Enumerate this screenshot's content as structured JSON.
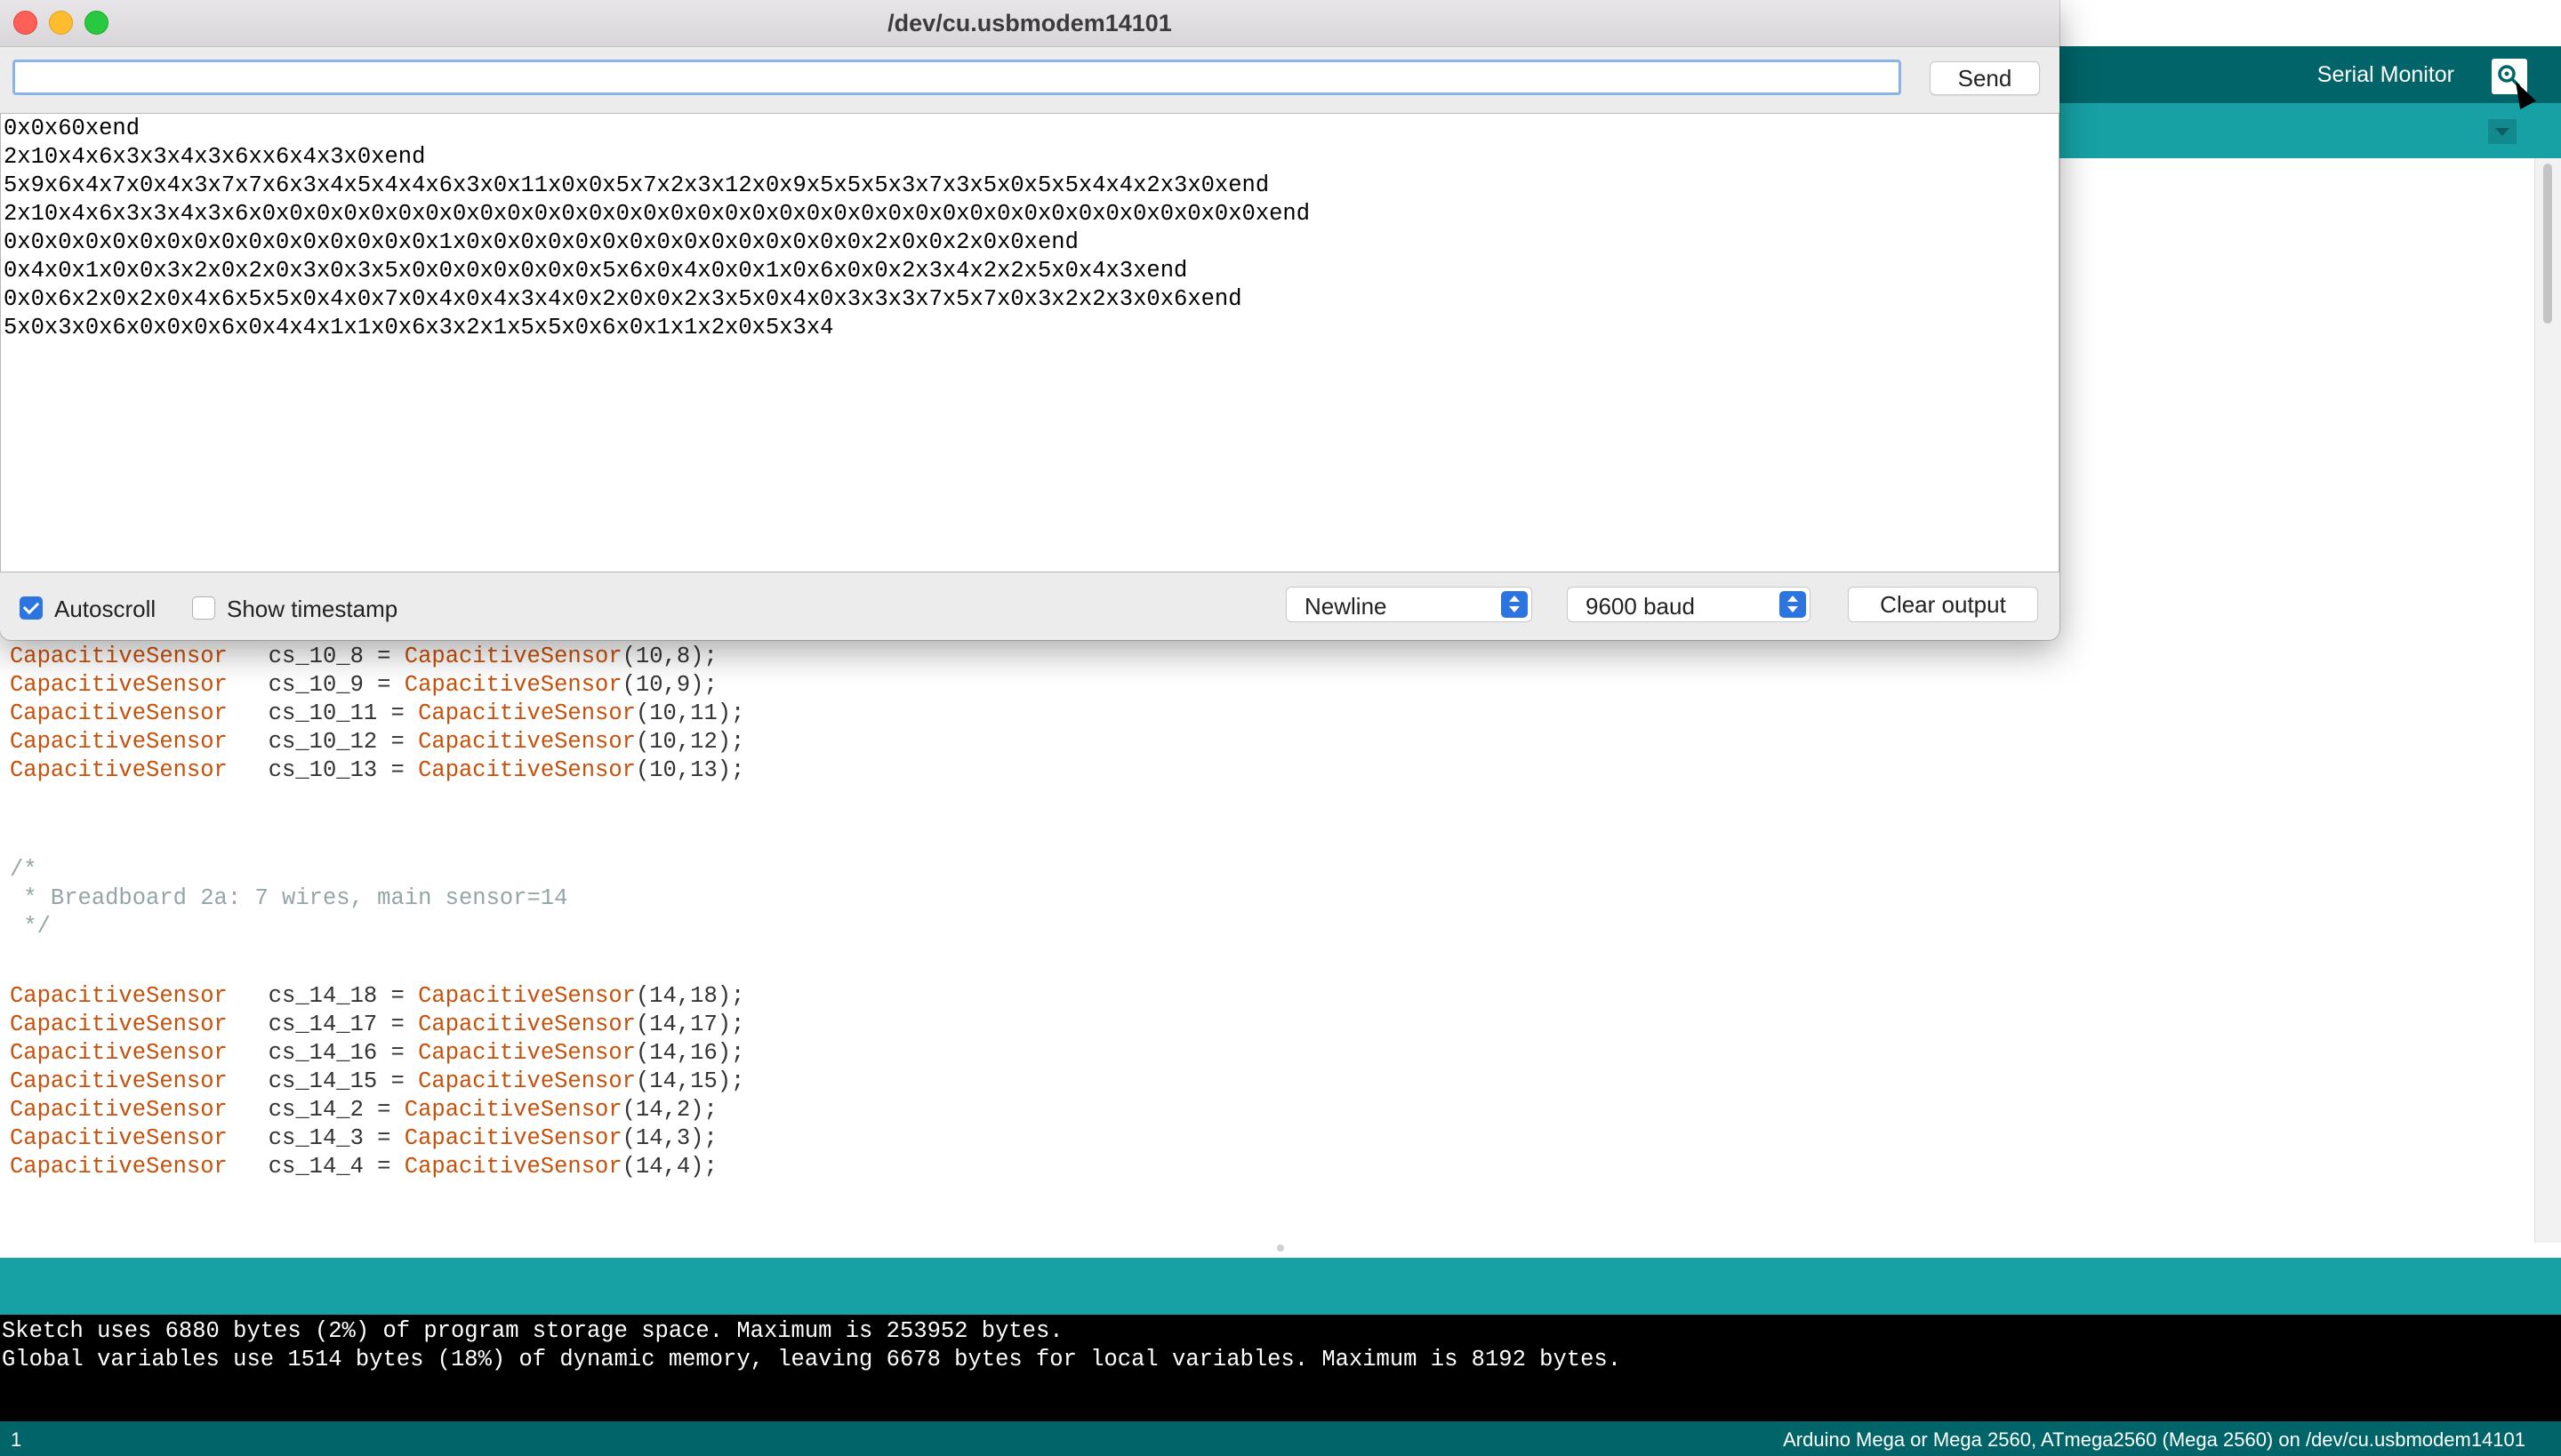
{
  "window": {
    "title": "/dev/cu.usbmodem14101"
  },
  "send": {
    "input_value": "",
    "send_label": "Send"
  },
  "output_lines": [
    "0x0x60xend",
    "2x10x4x6x3x3x4x3x6xx6x4x3x0xend",
    "5x9x6x4x7x0x4x3x7x7x6x3x4x5x4x4x6x3x0x11x0x0x5x7x2x3x12x0x9x5x5x5x3x7x3x5x0x5x5x4x4x2x3x0xend",
    "2x10x4x6x3x3x4x3x6x0x0x0x0x0x0x0x0x0x0x0x0x0x0x0x0x0x0x0x0x0x0x0x0x0x0x0x0x0x0x0x0x0x0x0x0x0xend",
    "0x0x0x0x0x0x0x0x0x0x0x0x0x0x0x0x1x0x0x0x0x0x0x0x0x0x0x0x0x0x0x0x2x0x0x2x0x0xend",
    "0x4x0x1x0x0x3x2x0x2x0x3x0x3x5x0x0x0x0x0x0x0x5x6x0x4x0x0x1x0x6x0x0x2x3x4x2x2x5x0x4x3xend",
    "0x0x6x2x0x2x0x4x6x5x5x0x4x0x7x0x4x0x4x3x4x0x2x0x0x2x3x5x0x4x0x3x3x3x7x5x7x0x3x2x2x3x0x6xend",
    "5x0x3x0x6x0x0x0x6x0x4x4x1x1x0x6x3x2x1x5x5x0x6x0x1x1x2x0x5x3x4"
  ],
  "bottom": {
    "autoscroll_label": "Autoscroll",
    "timestamp_label": "Show timestamp",
    "line_ending": "Newline",
    "baud": "9600 baud",
    "clear_label": "Clear output"
  },
  "ide": {
    "serial_monitor_label": "Serial Monitor",
    "code": {
      "block1": [
        {
          "type": "CapacitiveSensor",
          "var": "   cs_10_8 = ",
          "ctor": "CapacitiveSensor",
          "args": "(10,8);"
        },
        {
          "type": "CapacitiveSensor",
          "var": "   cs_10_9 = ",
          "ctor": "CapacitiveSensor",
          "args": "(10,9);"
        },
        {
          "type": "CapacitiveSensor",
          "var": "   cs_10_11 = ",
          "ctor": "CapacitiveSensor",
          "args": "(10,11);"
        },
        {
          "type": "CapacitiveSensor",
          "var": "   cs_10_12 = ",
          "ctor": "CapacitiveSensor",
          "args": "(10,12);"
        },
        {
          "type": "CapacitiveSensor",
          "var": "   cs_10_13 = ",
          "ctor": "CapacitiveSensor",
          "args": "(10,13);"
        }
      ],
      "comment": [
        "/*",
        " * Breadboard 2a: 7 wires, main sensor=14",
        " */"
      ],
      "block2": [
        {
          "type": "CapacitiveSensor",
          "var": "   cs_14_18 = ",
          "ctor": "CapacitiveSensor",
          "args": "(14,18);"
        },
        {
          "type": "CapacitiveSensor",
          "var": "   cs_14_17 = ",
          "ctor": "CapacitiveSensor",
          "args": "(14,17);"
        },
        {
          "type": "CapacitiveSensor",
          "var": "   cs_14_16 = ",
          "ctor": "CapacitiveSensor",
          "args": "(14,16);"
        },
        {
          "type": "CapacitiveSensor",
          "var": "   cs_14_15 = ",
          "ctor": "CapacitiveSensor",
          "args": "(14,15);"
        },
        {
          "type": "CapacitiveSensor",
          "var": "   cs_14_2 = ",
          "ctor": "CapacitiveSensor",
          "args": "(14,2);"
        },
        {
          "type": "CapacitiveSensor",
          "var": "   cs_14_3 = ",
          "ctor": "CapacitiveSensor",
          "args": "(14,3);"
        },
        {
          "type": "CapacitiveSensor",
          "var": "   cs_14_4 = ",
          "ctor": "CapacitiveSensor",
          "args": "(14,4);"
        }
      ]
    },
    "console": [
      "Sketch uses 6880 bytes (2%) of program storage space. Maximum is 253952 bytes.",
      "Global variables use 1514 bytes (18%) of dynamic memory, leaving 6678 bytes for local variables. Maximum is 8192 bytes."
    ],
    "status": {
      "line_number": "1",
      "board": "Arduino Mega or Mega 2560, ATmega2560 (Mega 2560) on /dev/cu.usbmodem14101"
    }
  },
  "icons": {
    "serial_monitor": "magnifier-icon",
    "tab_menu": "chevron-down-icon",
    "cursor": "mouse-pointer-icon"
  },
  "colors": {
    "ide_dark_teal": "#006468",
    "ide_light_teal": "#17a1a5",
    "keyword_orange": "#c7510a",
    "comment_gray": "#95a5a6",
    "mac_blue": "#2c74e0"
  }
}
